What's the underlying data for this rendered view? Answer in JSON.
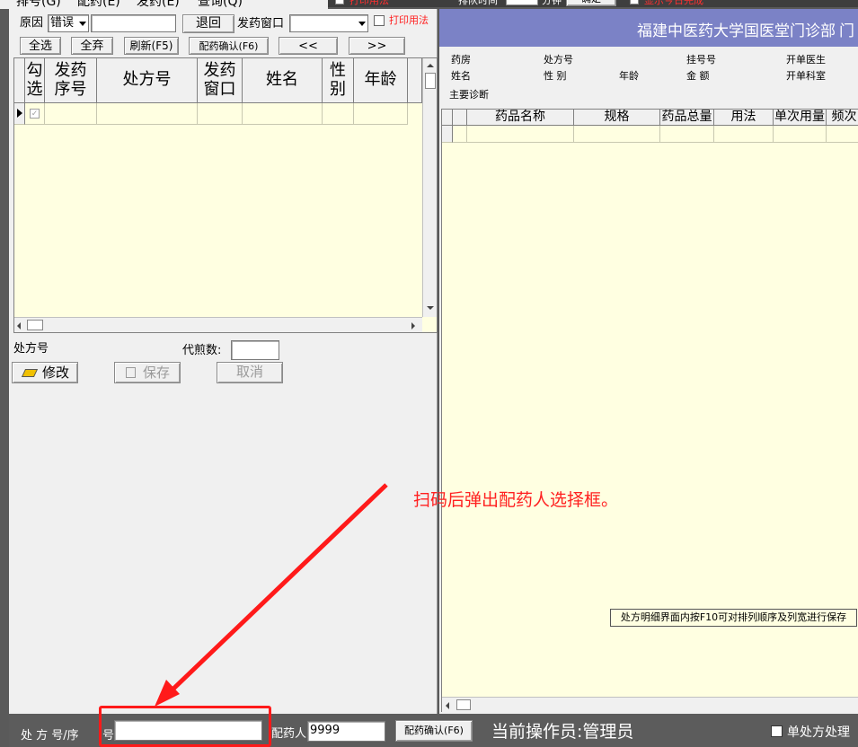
{
  "menu": {
    "items": [
      "排号(G)",
      "配药(E)",
      "发药(E)",
      "查询(Q)"
    ]
  },
  "top_strip": {
    "options": [
      "打印用法",
      "排队时间",
      "分钟",
      "确定",
      "显示今日完成"
    ]
  },
  "left": {
    "reason_label": "原因",
    "reason_value": "错误",
    "return_button": "退回",
    "window_label": "发药窗口",
    "print_usage": "打印用法",
    "buttons": {
      "select_all": "全选",
      "deselect_all": "全弃",
      "refresh": "刷新(F5)",
      "confirm": "配药确认(F6)",
      "prev": "<<",
      "next": ">>"
    },
    "columns": [
      "勾选",
      "发药序号",
      "处方号",
      "发药窗口",
      "姓名",
      "性别",
      "年龄"
    ],
    "rx_label": "处方号",
    "decoct_label": "代煎数:",
    "edit_button": "修改",
    "save_button": "保存",
    "cancel_button": "取消"
  },
  "right": {
    "title": "福建中医药大学国医堂门诊部",
    "title_tail": "门",
    "info": {
      "pharmacy": "药房",
      "rx_no": "处方号",
      "reg_no": "挂号号",
      "doctor": "开单医生",
      "name": "姓名",
      "gender": "性 别",
      "age": "年龄",
      "amount": "金 额",
      "dept": "开单科室",
      "diagnosis": "主要诊断"
    },
    "columns": [
      "药品名称",
      "规格",
      "药品总量",
      "用法",
      "单次用量",
      "频次"
    ],
    "hint": "处方明细界面内按F10可对排列顺序及列宽进行保存"
  },
  "annotation": "扫码后弹出配药人选择框。",
  "bottom": {
    "rx_label": "处 方 号/序",
    "rx_label_tail": "号",
    "dispenser_label": "配药人",
    "dispenser_value": "9999",
    "confirm_button": "配药确认(F6)",
    "operator": "当前操作员:管理员",
    "single_rx": "单处方处理"
  },
  "colors": {
    "panel": "#f0f0f0",
    "grid": "#ffffe1",
    "title_bar": "#7b82c6",
    "annotation": "#ff2020"
  }
}
